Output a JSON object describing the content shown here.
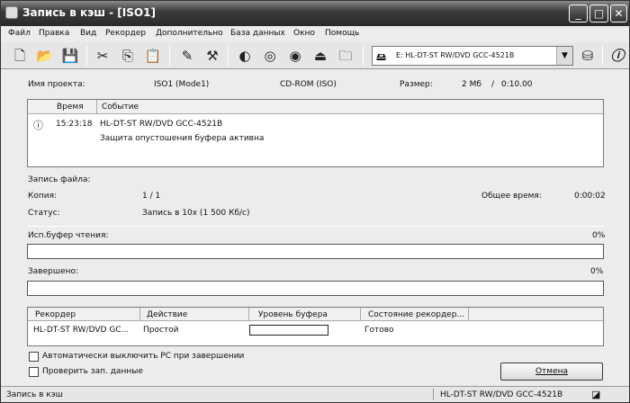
{
  "window": {
    "title": "Запись в кэш - [ISO1]"
  },
  "menu": [
    "Файл",
    "Правка",
    "Вид",
    "Рекордер",
    "Дополнительно",
    "База данных",
    "Окно",
    "Помощь"
  ],
  "drive_selector": {
    "value": "E: HL-DT-ST RW/DVD GCC-4521B"
  },
  "project": {
    "name_label": "Имя проекта:",
    "name_value": "ISO1 (Mode1)",
    "type_value": "CD-ROM (ISO)",
    "size_label": "Размер:",
    "size_value": "2 Мб",
    "size_sep": "/",
    "size_time": "0:10.00"
  },
  "log": {
    "columns": [
      "Время",
      "Событие"
    ],
    "rows": [
      {
        "time": "15:23:18",
        "event": "HL-DT-ST RW/DVD GCC-4521B",
        "detail": "Защита опустошения буфера активна"
      }
    ]
  },
  "write": {
    "section_label": "Запись файла:",
    "copy_label": "Копия:",
    "copy_value": "1 / 1",
    "total_time_label": "Общее время:",
    "total_time_value": "0:00:02",
    "status_label": "Статус:",
    "status_value": "Запись в 10x (1 500 Кб/с)"
  },
  "read_buffer": {
    "label": "Исп.буфер чтения:",
    "percent": "0%",
    "value": 0
  },
  "completed": {
    "label": "Завершено:",
    "percent": "0%",
    "value": 0
  },
  "recorder_table": {
    "columns": [
      "Рекордер",
      "Действие",
      "Уровень буфера",
      "Состояние рекордер..."
    ],
    "rows": [
      {
        "recorder": "HL-DT-ST RW/DVD GC...",
        "action": "Простой",
        "buffer_level": 0,
        "state": "Готово"
      }
    ]
  },
  "options": {
    "auto_shutdown": "Автоматически выключить PC при завершении",
    "verify": "Проверить зап. данные"
  },
  "cancel_button": "Отмена",
  "statusbar": {
    "left": "Запись в кэш",
    "right": "HL-DT-ST RW/DVD GCC-4521B"
  }
}
